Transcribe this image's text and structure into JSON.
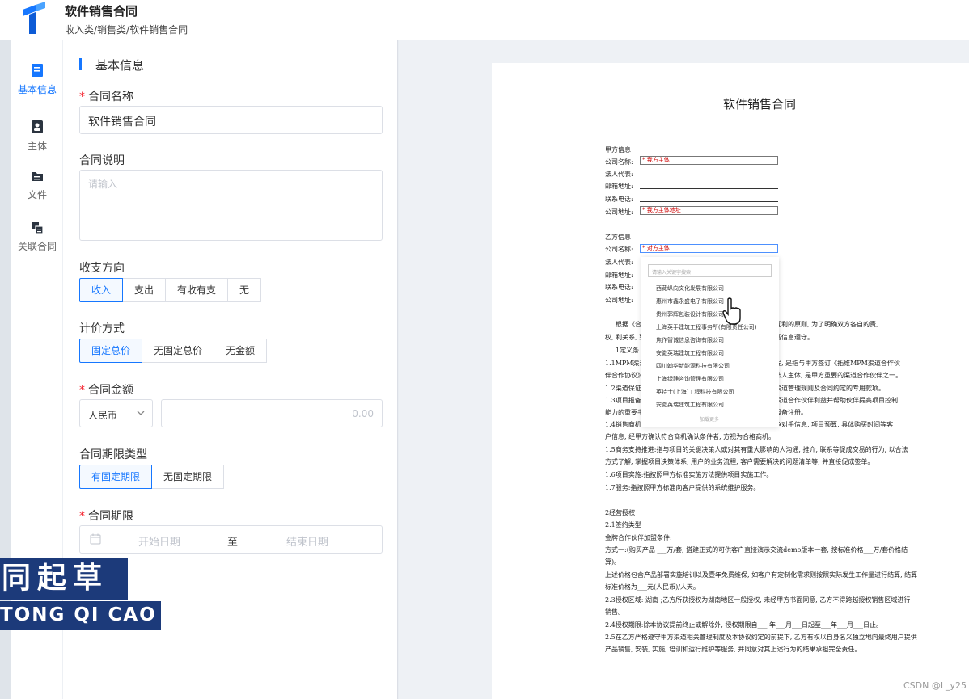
{
  "header": {
    "title": "软件销售合同",
    "breadcrumb": "收入类/销售类/软件销售合同"
  },
  "sidebar": {
    "items": [
      {
        "label": "基本信息",
        "icon": "form-icon",
        "active": true
      },
      {
        "label": "主体",
        "icon": "contact-icon",
        "active": false
      },
      {
        "label": "文件",
        "icon": "folder-icon",
        "active": false
      },
      {
        "label": "关联合同",
        "icon": "link-contract-icon",
        "active": false
      }
    ]
  },
  "form": {
    "section_title": "基本信息",
    "contract_name_label": "合同名称",
    "contract_name_value": "软件销售合同",
    "contract_desc_label": "合同说明",
    "contract_desc_placeholder": "请输入",
    "direction_label": "收支方向",
    "direction_options": [
      "收入",
      "支出",
      "有收有支",
      "无"
    ],
    "direction_selected": "收入",
    "pricing_label": "计价方式",
    "pricing_options": [
      "固定总价",
      "无固定总价",
      "无金额"
    ],
    "pricing_selected": "固定总价",
    "amount_label": "合同金额",
    "currency": "人民币",
    "amount_placeholder": "0.00",
    "term_type_label": "合同期限类型",
    "term_type_options": [
      "有固定期限",
      "无固定期限"
    ],
    "term_type_selected": "有固定期限",
    "term_label": "合同期限",
    "start_placeholder": "开始日期",
    "range_sep": "至",
    "end_placeholder": "结束日期"
  },
  "watermark": {
    "line1": "同起草",
    "line2": "TONG QI CAO"
  },
  "preview": {
    "title": "软件销售合同",
    "party_a_title": "甲方信息",
    "party_a_fields": [
      "公司名称:",
      "法人代表:",
      "邮箱地址:",
      "联系电话:",
      "公司地址:"
    ],
    "party_a_company_placeholder": "* 我方主体",
    "party_a_address_placeholder": "* 我方主体地址",
    "party_b_title": "乙方信息",
    "party_b_fields": [
      "公司名称:",
      "法人代表:",
      "邮箱地址:",
      "联系电话:",
      "公司地址:"
    ],
    "party_b_company_placeholder": "* 对方主体",
    "dropdown_search": "请输入关键字搜索",
    "dropdown_items": [
      "西藏纵向文化发展有限公司",
      "惠州市鑫永盛电子有限公司",
      "贵州郭辉包装设计有限公司",
      "上海英手建筑工程事务所(有限责任公司)",
      "焦作智诚信息咨询有限公司",
      "安徽英瑞建筑工程有限公司",
      "四川翰华新能源科技有限公司",
      "上海绿静咨询管理有限公司",
      "英特士(上海)工程科技有限公司",
      "安徽英瑞建筑工程有限公司"
    ],
    "dropdown_more": "加载更多",
    "body_lines": [
      "根据《合",
      "权, 利关系, 到",
      "1定义条",
      "1.1MPM渠道",
      "伴合作协议》",
      "1.2渠道保证",
      "1.3项目报备",
      "能力的重要手",
      "1.4销售商机",
      "户信息, 经甲方确认符合商机确认条件者, 方视为合格商机。",
      "1.5商务支持推进:指与项目的关键决策人或对其有重大影响的人沟通, 推介, 联系等促成交易的行为, 以合法",
      "方式了解, 掌握项目决策体系, 用户的业务流程, 客户需要解决的问题清单等, 并直接促成签单。",
      "1.6项目实施:指按照甲方标准实施方法提供项目实施工作。",
      "1.7服务:指按照甲方标准向客户提供的系统维护服务。",
      "2经营授权",
      "2.1签约类型",
      "金牌合作伙伴加盟条件:",
      "方式一:(购买产品     ___万/套, 搭建正式的可供客户直接演示交流demo版本一套, 按标准价格___万/套价格结",
      "算)。",
      "上述价格包含产品部署实施培训以及壹年免费维保, 如客户有定制化需求则按照实际发生工作量进行结算, 结算",
      "标准价格为___元(人民币)/人天。",
      "2.3授权区域:   湖南 ;乙方所获授权为湖南地区一般授权, 未经甲方书面同意, 乙方不得跨越授权销售区域进行",
      "销售。",
      "2.4授权期限:除本协议提前终止或解除外, 授权期限自___     年___月___日起至___年___月___日止。",
      "2.5在乙方严格遵守甲方渠道相关管理制度及本协议约定的前提下, 乙方有权以自身名义独立地向最终用户提供",
      "产品销售, 安装, 实施, 培训和运行维护等服务, 并同意对其上述行为的结果承担完全责任。"
    ],
    "right_fragments": [
      "互利的原则, 为了明确双方各自的责,",
      "诚信息遵守。",
      "程, 是指与甲方签订《拓维MPM渠道合作伙",
      "法人主体, 是甲方重要的渠道合作伙伴之一。",
      "渠道管理规则及合同约定的专用款项。",
      "渠道合作伙伴利益并帮助伙伴提高项目控制",
      "报备注册。",
      "争对手信息, 项目预算,         具体购买时间等客"
    ]
  },
  "footer": {
    "credit": "CSDN @L_y25"
  },
  "colors": {
    "accent": "#1677ff",
    "required": "#f5222d",
    "watermark_bg": "#1c3a7a"
  }
}
